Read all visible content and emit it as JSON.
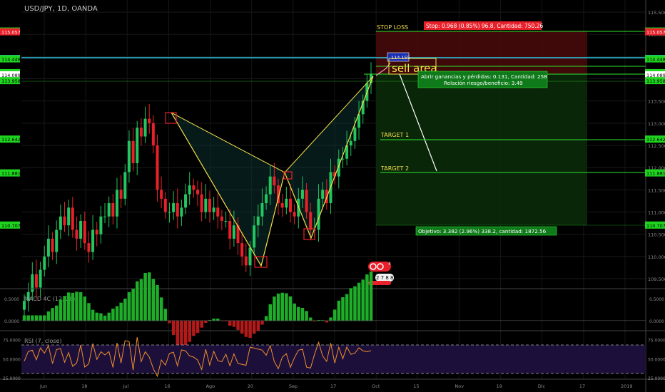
{
  "symbol_title": "USD/JPY, 1D, OANDA",
  "colors": {
    "background": "#000000",
    "up_candle": "#22c55e",
    "down_candle": "#e8202a",
    "pattern": "#f5e04a",
    "target_line": "#2ee62e",
    "entry_line": "#2ecbe8",
    "stop_zone": "#5a0a0a",
    "profit_zone": "#0b2e0b",
    "rsi": "#f0902a",
    "macd_up": "#1fae2a",
    "macd_down": "#b51a1a"
  },
  "chart_data": [
    {
      "type": "candlestick",
      "title": "USD/JPY, 1D, OANDA",
      "x_ticks": [
        "Jun",
        "18",
        "Jul",
        "16",
        "Ago",
        "20",
        "Sep",
        "17",
        "Oct",
        "15",
        "Nov",
        "19",
        "Dic",
        "17",
        "2019"
      ],
      "y_ticks": [
        "115.500",
        "115.000",
        "114.500",
        "114.000",
        "113.500",
        "113.000",
        "112.500",
        "112.000",
        "111.500",
        "111.000",
        "110.500",
        "110.000",
        "109.500"
      ],
      "ylim": [
        109.5,
        115.5
      ],
      "price_labels": [
        {
          "text": "115.074",
          "kind": "green"
        },
        {
          "text": "115.057",
          "kind": "red"
        },
        {
          "text": "114.456",
          "kind": "cyan"
        },
        {
          "text": "114.448",
          "kind": "green"
        },
        {
          "text": "114.138",
          "kind": "green"
        },
        {
          "text": "114.089",
          "kind": "white"
        },
        {
          "text": "113.958",
          "kind": "green"
        },
        {
          "text": "112.642",
          "kind": "green"
        },
        {
          "text": "111.881",
          "kind": "green"
        },
        {
          "text": "110.707",
          "kind": "green"
        }
      ],
      "close_series": [
        109.0,
        109.2,
        109.6,
        109.3,
        109.7,
        110.0,
        110.4,
        110.1,
        110.6,
        110.9,
        110.7,
        111.1,
        110.6,
        110.4,
        110.8,
        110.3,
        110.1,
        110.6,
        110.5,
        110.9,
        110.9,
        111.2,
        110.9,
        111.5,
        111.3,
        111.9,
        112.6,
        112.1,
        112.9,
        112.7,
        113.1,
        113.0,
        112.5,
        111.5,
        111.3,
        111.0,
        111.0,
        111.2,
        110.9,
        111.1,
        111.4,
        111.6,
        111.5,
        111.4,
        111.0,
        111.3,
        111.0,
        111.1,
        110.9,
        110.8,
        110.8,
        110.4,
        110.7,
        110.3,
        110.0,
        109.8,
        110.2,
        110.7,
        110.9,
        111.2,
        111.4,
        111.8,
        111.6,
        111.2,
        111.1,
        111.3,
        111.0,
        110.9,
        111.3,
        111.5,
        111.0,
        110.6,
        110.6,
        111.3,
        111.5,
        111.2,
        111.9,
        111.8,
        112.2,
        112.2,
        112.5,
        112.6,
        112.9,
        113.2,
        113.5,
        113.9,
        114.1
      ],
      "series": [
        {
          "name": "X",
          "x": 0,
          "y": 113.1
        },
        {
          "name": "A",
          "x": 1,
          "y": 109.8
        },
        {
          "name": "B",
          "x": 2,
          "y": 111.8
        },
        {
          "name": "C",
          "x": 3,
          "y": 110.4
        },
        {
          "name": "D",
          "x": 4,
          "y": 114.1
        }
      ],
      "annotations": {
        "stop_loss_label": "STOP LOSS",
        "stop_info": "Stop: 0.968 (0.85%) 96.8, Cantidad: 750.26",
        "entry_marker": "114.155",
        "sell_area": "sell area",
        "pnl_line1": "Abrir ganancias y pérdidas: 0.131, Cantidad: 258",
        "pnl_line2": "Relación riesgo/beneficio: 3.49",
        "target1": "TARGET 1",
        "target2": "TARGET 2",
        "objective": "Objetivo: 3.382 (2.96%) 338.2, cantidad: 1872.56",
        "logo_top": "4",
        "logo_bottom": "2 7 8 8"
      }
    },
    {
      "type": "area",
      "title": "MACD 4C (12, 26)",
      "y_ticks": [
        "0.5000",
        "0.0000"
      ],
      "ylim": [
        -0.2,
        0.7
      ]
    },
    {
      "type": "line",
      "title": "RSI (7, close)",
      "y_ticks": [
        "75.0000",
        "50.0000",
        "25.0000"
      ],
      "ylim": [
        25,
        85
      ],
      "levels": [
        70,
        30
      ]
    }
  ]
}
